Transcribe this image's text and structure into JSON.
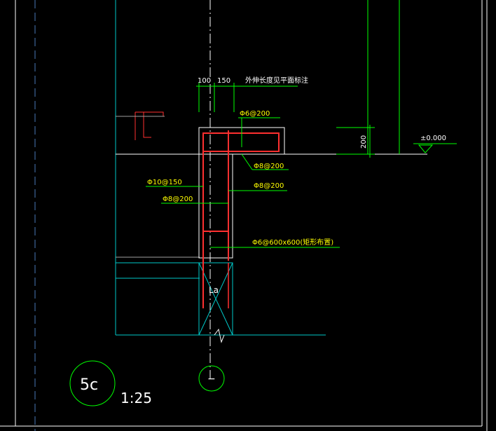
{
  "drawing": {
    "dimensions": {
      "dim_100": "100",
      "dim_150": "150",
      "extension_note": "外伸长度见平面标注",
      "dim_200": "200"
    },
    "elevation": "±0.000",
    "rebar_labels": {
      "top_slab": "Φ6@200",
      "top_hook": "Φ8@200",
      "left_1": "Φ10@150",
      "left_2": "Φ8@200",
      "right_1": "Φ8@200",
      "tie": "Φ6@600x600(矩形布置)"
    },
    "la_label": "La",
    "detail": {
      "number": "5c",
      "scale": "1:25"
    },
    "section_marker": "−"
  },
  "colors": {
    "background": "#000000",
    "white_line": "#ffffff",
    "cyan": "#00c8c8",
    "green": "#00ff00",
    "yellow": "#ffff00",
    "red": "#ff3030",
    "grey": "#a0a0a0",
    "dash_blue": "#4a7ab8"
  }
}
